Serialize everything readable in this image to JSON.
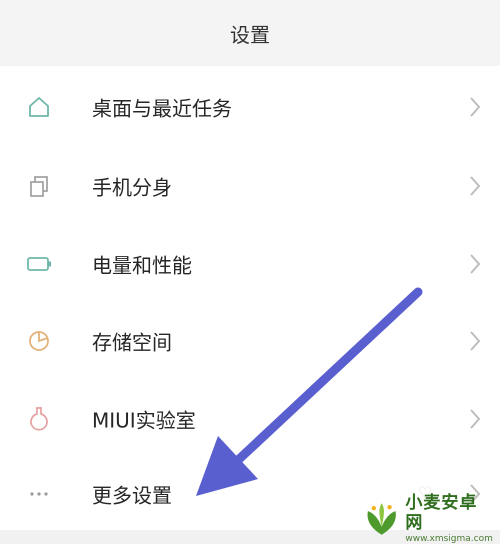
{
  "header": {
    "title": "设置"
  },
  "items": [
    {
      "label": "桌面与最近任务",
      "icon": "home-icon",
      "color": "#6fb7aa"
    },
    {
      "label": "手机分身",
      "icon": "clone-icon",
      "color": "#9a9a9a"
    },
    {
      "label": "电量和性能",
      "icon": "battery-icon",
      "color": "#6fb7aa"
    },
    {
      "label": "存储空间",
      "icon": "storage-pie-icon",
      "color": "#e3b27a"
    },
    {
      "label": "MIUI实验室",
      "icon": "flask-icon",
      "color": "#e6a1a1"
    },
    {
      "label": "更多设置",
      "icon": "more-dots-icon",
      "color": "#9a9a9a"
    }
  ],
  "annotation": {
    "arrow_color": "#5a5fd0",
    "icon": "pointer-arrow-icon"
  },
  "watermark": {
    "title": "小麦安卓网",
    "url": "www.xmsigma.com",
    "icon": "logo-icon"
  }
}
